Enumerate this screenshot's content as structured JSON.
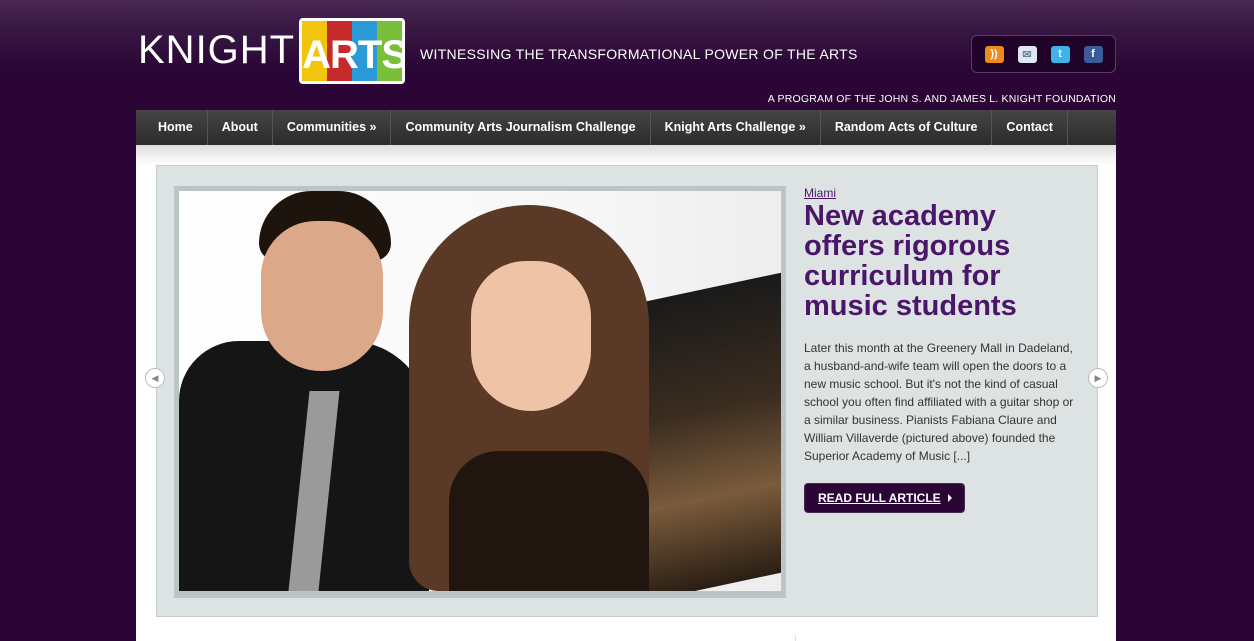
{
  "header": {
    "logo_word": "KNIGHT",
    "logo_arts": "ARTS",
    "logo_colors": [
      "#f2c30f",
      "#c62a2a",
      "#2a9bd6",
      "#7abf3a"
    ],
    "tagline": "WITNESSING THE TRANSFORMATIONAL POWER OF THE ARTS",
    "program": "A PROGRAM OF THE JOHN S. AND JAMES L. KNIGHT FOUNDATION",
    "social_icons": [
      "rss-icon",
      "mail-icon",
      "twitter-icon",
      "facebook-icon"
    ]
  },
  "nav": {
    "items": [
      {
        "label": "Home"
      },
      {
        "label": "About"
      },
      {
        "label": "Communities »"
      },
      {
        "label": "Community Arts Journalism Challenge"
      },
      {
        "label": "Knight Arts Challenge »"
      },
      {
        "label": "Random Acts of Culture"
      },
      {
        "label": "Contact"
      }
    ]
  },
  "slide": {
    "category": "Miami",
    "headline": "New academy offers rigorous curriculum for music students",
    "excerpt": "Later this month at the Greenery Mall in Dadeland, a husband-and-wife team will open the doors to a new music school. But it's not the kind of casual school you often find affiliated with a guitar shop or a similar business. Pianists Fabiana Claure and William Villaverde (pictured above) founded the Superior Academy of Music [...]",
    "button_label": "READ FULL ARTICLE"
  },
  "colors": {
    "background": "#2a0535",
    "headline": "#4a1669",
    "nav": "#333333"
  }
}
